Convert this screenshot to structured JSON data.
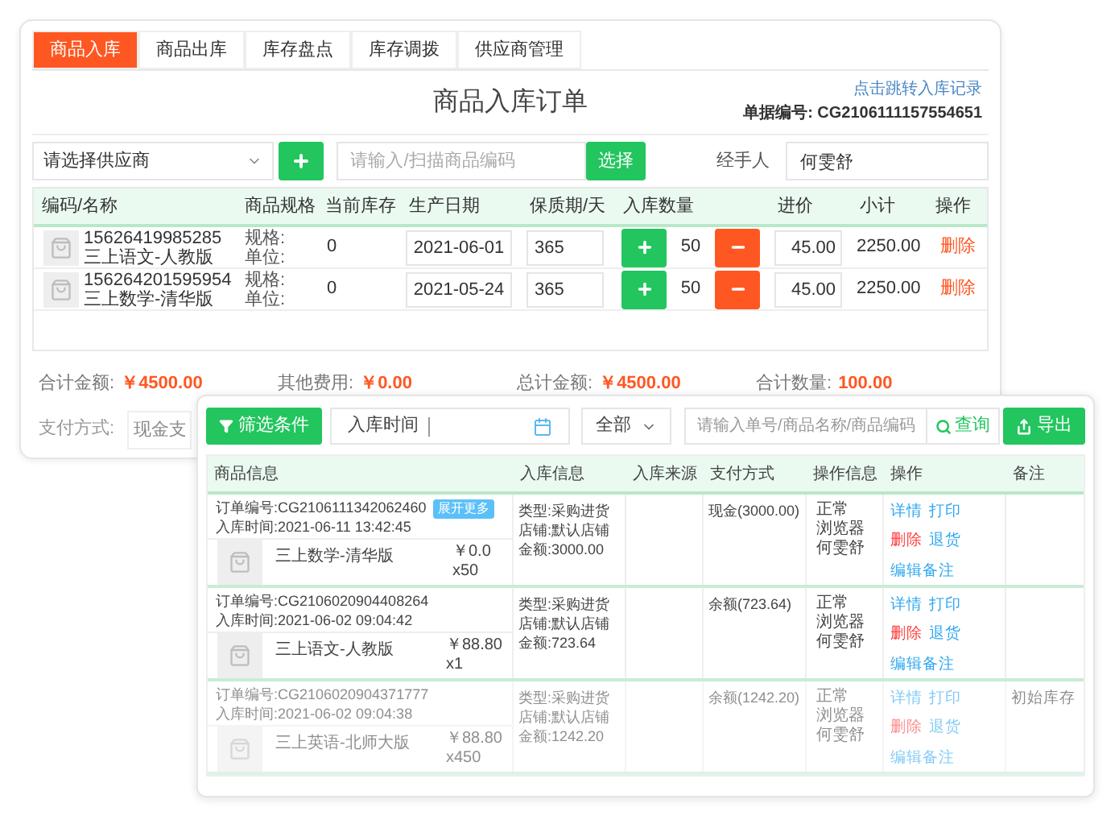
{
  "entry_panel": {
    "tabs": [
      {
        "label": "商品入库",
        "selected": true
      },
      {
        "label": "商品出库",
        "selected": false
      },
      {
        "label": "库存盘点",
        "selected": false
      },
      {
        "label": "库存调拨",
        "selected": false
      },
      {
        "label": "供应商管理",
        "selected": false
      }
    ],
    "title": "商品入库订单",
    "record_link": "点击跳转入库记录",
    "doc_number": "单据编号: CG2106111157554651",
    "supplier_select": {
      "placeholder": "请选择供应商"
    },
    "scan_input": {
      "placeholder": "请输入/扫描商品编码"
    },
    "choose_button": "选择",
    "handler": {
      "label": "经手人",
      "value": "何雯舒"
    },
    "table": {
      "columns": [
        "编码/名称",
        "商品规格",
        "当前库存",
        "生产日期",
        "保质期/天",
        "入库数量",
        "进价",
        "小计",
        "操作"
      ],
      "rows": [
        {
          "code": "15626419985285",
          "name": "三上语文-人教版",
          "spec_label": "规格:",
          "unit_label": "单位:",
          "stock": "0",
          "production_date": "2021-06-01",
          "shelf_life": "365",
          "quantity": "50",
          "price": "45.00",
          "subtotal": "2250.00",
          "action": "删除"
        },
        {
          "code": "156264201595954",
          "name": "三上数学-清华版",
          "spec_label": "规格:",
          "unit_label": "单位:",
          "stock": "0",
          "production_date": "2021-05-24",
          "shelf_life": "365",
          "quantity": "50",
          "price": "45.00",
          "subtotal": "2250.00",
          "action": "删除"
        }
      ]
    },
    "summary": [
      {
        "label": "合计金额:",
        "value": "￥4500.00"
      },
      {
        "label": "其他费用:",
        "value": "￥0.00"
      },
      {
        "label": "总计金额:",
        "value": "￥4500.00"
      },
      {
        "label": "合计数量:",
        "value": "100.00"
      }
    ],
    "payment": {
      "label": "支付方式:",
      "value": "现金支"
    }
  },
  "records_panel": {
    "filter_button": "筛选条件",
    "date_filter": {
      "label": "入库时间"
    },
    "status_select": {
      "value": "全部"
    },
    "search": {
      "placeholder": "请输入单号/商品名称/商品编码"
    },
    "search_button": "查询",
    "export_button": "导出",
    "table": {
      "columns": [
        "商品信息",
        "入库信息",
        "入库来源",
        "支付方式",
        "操作信息",
        "操作",
        "备注"
      ],
      "rows": [
        {
          "order_no": "订单编号:CG2106111342062460",
          "time": "入库时间:2021-06-11 13:42:45",
          "expand_label": "展开更多",
          "product": {
            "name": "三上数学-清华版",
            "price": "￥0.0",
            "qty": "x50"
          },
          "info": [
            "类型:采购进货",
            "店铺:默认店铺",
            "金额:3000.00"
          ],
          "payment": "现金(3000.00)",
          "operator_info": [
            "正常",
            "浏览器",
            "何雯舒"
          ],
          "actions": [
            {
              "label": "详情",
              "kind": "link"
            },
            {
              "label": "打印",
              "kind": "link"
            },
            {
              "label": "删除",
              "kind": "danger"
            },
            {
              "label": "退货",
              "kind": "link"
            },
            {
              "label": "编辑备注",
              "kind": "link"
            }
          ],
          "faded": false
        },
        {
          "order_no": "订单编号:CG2106020904408264",
          "time": "入库时间:2021-06-02 09:04:42",
          "product": {
            "name": "三上语文-人教版",
            "price": "￥88.80",
            "qty": "x1"
          },
          "info": [
            "类型:采购进货",
            "店铺:默认店铺",
            "金额:723.64"
          ],
          "payment": "余额(723.64)",
          "operator_info": [
            "正常",
            "浏览器",
            "何雯舒"
          ],
          "actions": [
            {
              "label": "详情",
              "kind": "link"
            },
            {
              "label": "打印",
              "kind": "link"
            },
            {
              "label": "删除",
              "kind": "danger"
            },
            {
              "label": "退货",
              "kind": "link"
            },
            {
              "label": "编辑备注",
              "kind": "link"
            }
          ],
          "faded": false
        },
        {
          "order_no": "订单编号:CG2106020904371777",
          "time": "入库时间:2021-06-02 09:04:38",
          "product": {
            "name": "三上英语-北师大版",
            "price": "￥88.80",
            "qty": "x450"
          },
          "info": [
            "类型:采购进货",
            "店铺:默认店铺",
            "金额:1242.20"
          ],
          "payment": "余额(1242.20)",
          "operator_info": [
            "正常",
            "浏览器",
            "何雯舒"
          ],
          "actions": [
            {
              "label": "详情",
              "kind": "link"
            },
            {
              "label": "打印",
              "kind": "link"
            },
            {
              "label": "删除",
              "kind": "danger"
            },
            {
              "label": "退货",
              "kind": "link"
            },
            {
              "label": "编辑备注",
              "kind": "link"
            }
          ],
          "note": "初始库存",
          "faded": true
        }
      ]
    }
  }
}
